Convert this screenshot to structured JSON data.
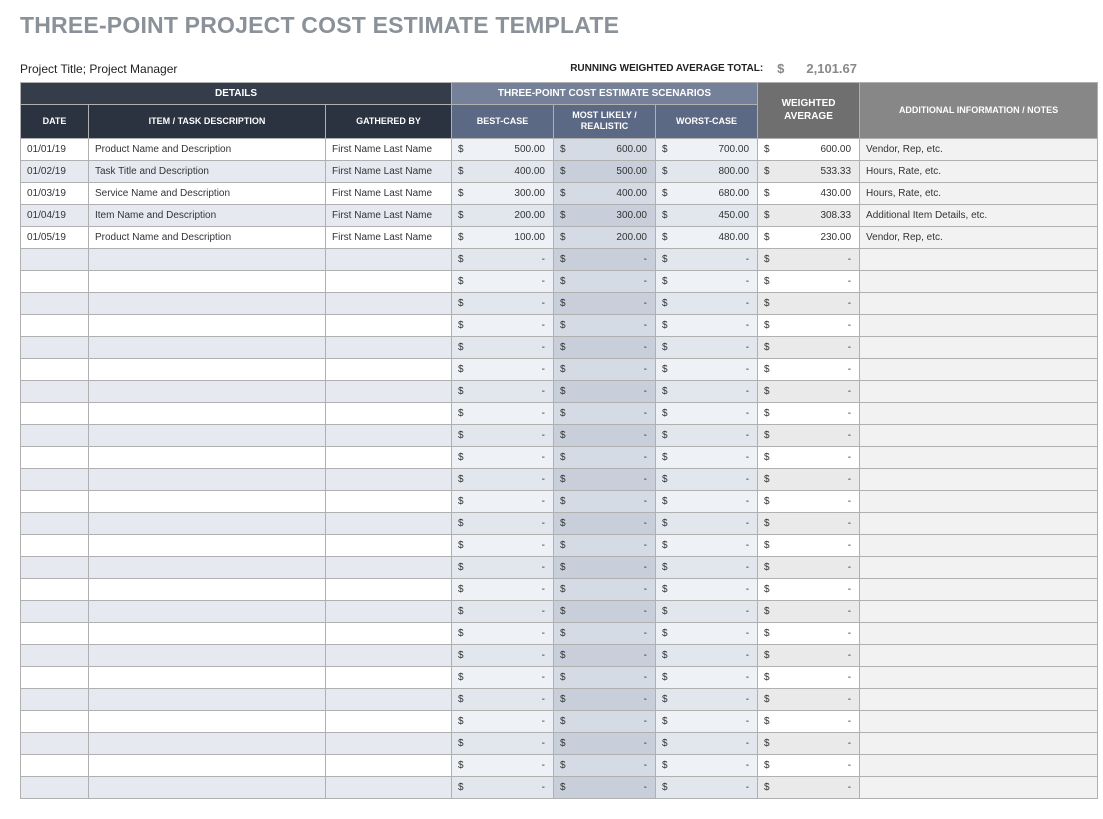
{
  "title": "THREE-POINT PROJECT COST ESTIMATE TEMPLATE",
  "subtitle": "Project Title; Project Manager",
  "total_label": "RUNNING WEIGHTED AVERAGE TOTAL:",
  "total_dollar": "$",
  "total_value": "2,101.67",
  "headers": {
    "details": "DETAILS",
    "scenarios": "THREE-POINT COST ESTIMATE SCENARIOS",
    "date": "DATE",
    "desc": "ITEM / TASK DESCRIPTION",
    "gathered": "GATHERED BY",
    "best": "BEST-CASE",
    "likely": "MOST LIKELY / REALISTIC",
    "worst": "WORST-CASE",
    "weighted": "WEIGHTED AVERAGE",
    "notes": "ADDITIONAL INFORMATION / NOTES"
  },
  "rows": [
    {
      "date": "01/01/19",
      "desc": "Product Name and Description",
      "gath": "First Name Last Name",
      "bc": "500.00",
      "ml": "600.00",
      "wc": "700.00",
      "wa": "600.00",
      "notes": "Vendor, Rep, etc."
    },
    {
      "date": "01/02/19",
      "desc": "Task Title and Description",
      "gath": "First Name Last Name",
      "bc": "400.00",
      "ml": "500.00",
      "wc": "800.00",
      "wa": "533.33",
      "notes": "Hours, Rate, etc."
    },
    {
      "date": "01/03/19",
      "desc": "Service Name and Description",
      "gath": "First Name Last Name",
      "bc": "300.00",
      "ml": "400.00",
      "wc": "680.00",
      "wa": "430.00",
      "notes": "Hours, Rate, etc."
    },
    {
      "date": "01/04/19",
      "desc": "Item Name and Description",
      "gath": "First Name Last Name",
      "bc": "200.00",
      "ml": "300.00",
      "wc": "450.00",
      "wa": "308.33",
      "notes": "Additional Item Details, etc."
    },
    {
      "date": "01/05/19",
      "desc": "Product Name and Description",
      "gath": "First Name Last Name",
      "bc": "100.00",
      "ml": "200.00",
      "wc": "480.00",
      "wa": "230.00",
      "notes": "Vendor, Rep, etc."
    }
  ],
  "empty_count": 25,
  "dash": "-"
}
